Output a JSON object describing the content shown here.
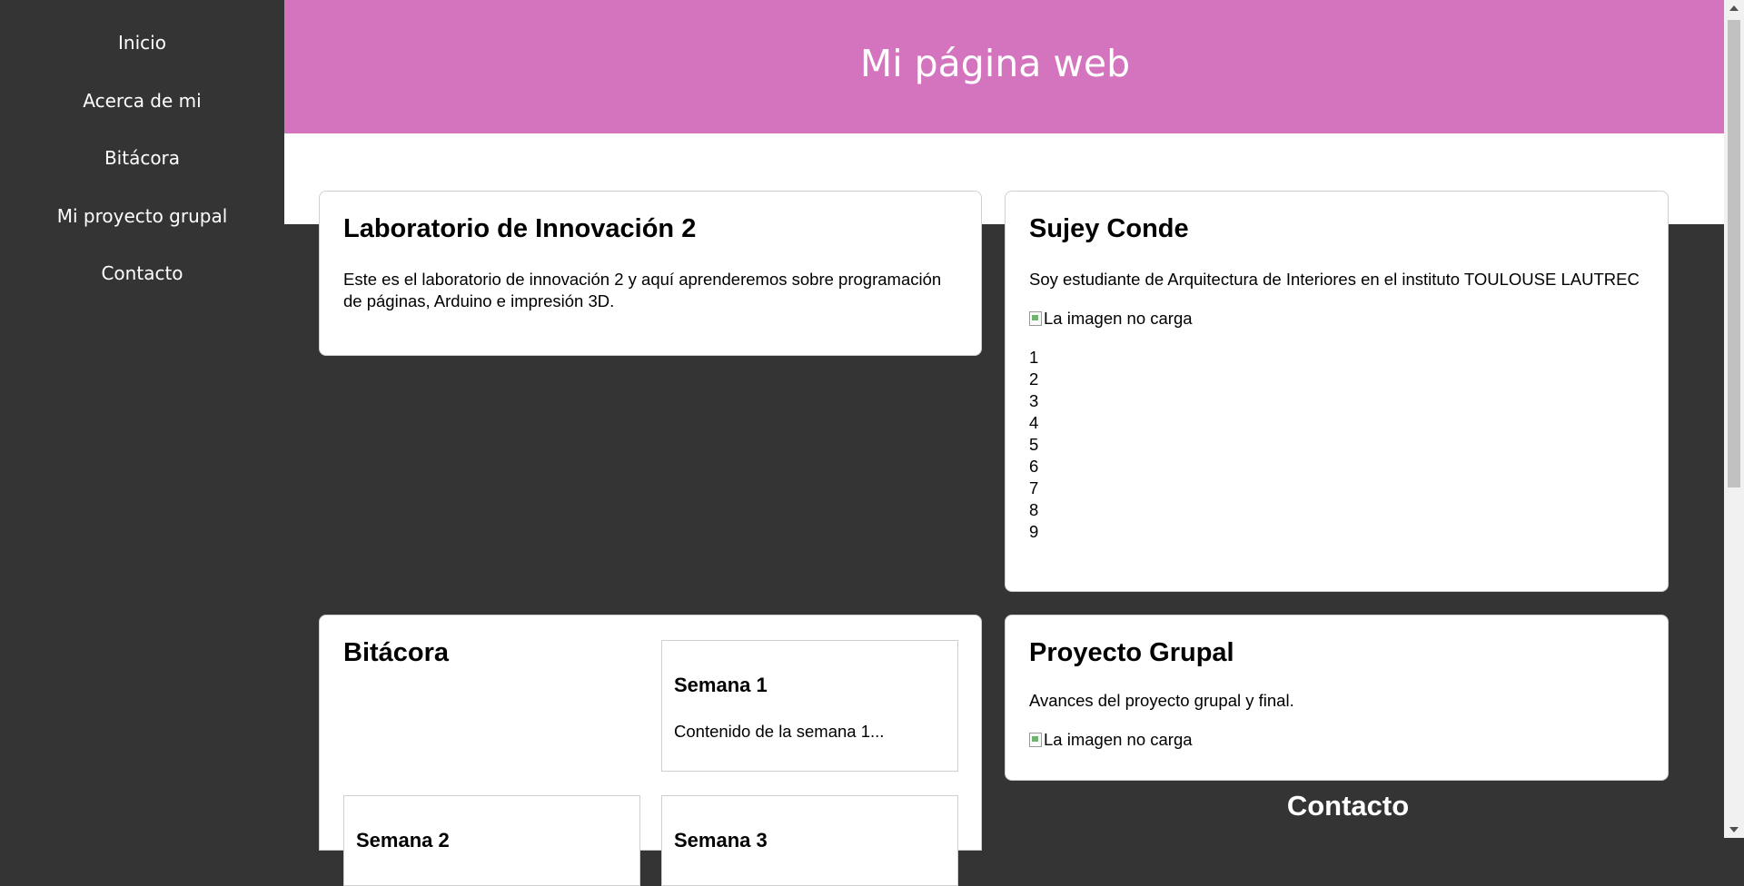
{
  "nav": {
    "items": [
      "Inicio",
      "Acerca de mi",
      "Bitácora",
      "Mi proyecto grupal",
      "Contacto"
    ]
  },
  "header": {
    "title": "Mi página web"
  },
  "lab_card": {
    "title": "Laboratorio de Innovación 2",
    "text": "Este es el laboratorio de innovación 2 y aquí aprenderemos sobre programación de páginas, Arduino e impresión 3D."
  },
  "profile_card": {
    "title": "Sujey Conde",
    "text": "Soy estudiante de Arquitectura de Interiores en el instituto TOULOUSE LAUTREC",
    "image_alt": "La imagen no carga",
    "numbers": [
      "1",
      "2",
      "3",
      "4",
      "5",
      "6",
      "7",
      "8",
      "9"
    ]
  },
  "bitacora_card": {
    "title": "Bitácora",
    "weeks": [
      {
        "title": "Semana 1",
        "content": "Contenido de la semana 1..."
      },
      {
        "title": "Semana 2"
      },
      {
        "title": "Semana 3"
      }
    ]
  },
  "project_card": {
    "title": "Proyecto Grupal",
    "text": "Avances del proyecto grupal y final.",
    "image_alt": "La imagen no carga"
  },
  "contact": {
    "title": "Contacto"
  },
  "colors": {
    "header": "#d574be",
    "background": "#343434",
    "card": "#ffffff"
  }
}
